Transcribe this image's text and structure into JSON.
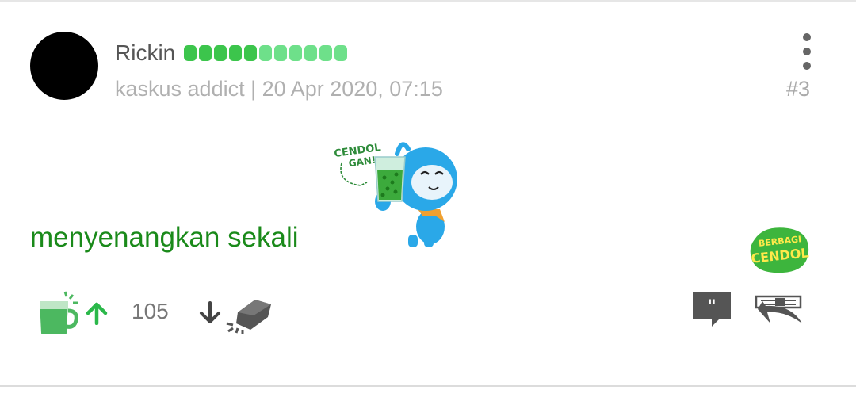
{
  "post": {
    "username": "Rickin",
    "reputation": {
      "filled_dots": 5,
      "total_dots": 11
    },
    "rank": "kaskus addict",
    "separator": "|",
    "timestamp": "20 Apr 2020, 07:15",
    "post_number": "#3",
    "body_text": "menyenangkan sekali",
    "sticker": {
      "caption_line1": "CENDOL",
      "caption_line2": "GAN!"
    },
    "berbagi_badge": {
      "line1": "BERBAGI",
      "line2": "CENDOL"
    }
  },
  "actions": {
    "score": "105"
  },
  "icons": {
    "menu": "kebab-menu-icon",
    "cendol": "cendol-cup-icon",
    "upvote": "arrow-up-icon",
    "downvote": "arrow-down-icon",
    "bata": "brick-icon",
    "reply": "reply-bubble-icon",
    "quote": "quote-icon"
  },
  "colors": {
    "text_green": "#1a8a1a",
    "rep_green": "#3cc54c",
    "rep_light": "#6ee08a",
    "arrow_green": "#2bb84a",
    "cup_green": "#4cb860",
    "kaskus_blue": "#2aa8e8",
    "badge_green": "#3db53d",
    "badge_yellow": "#ffe94a",
    "icon_gray": "#555555"
  }
}
